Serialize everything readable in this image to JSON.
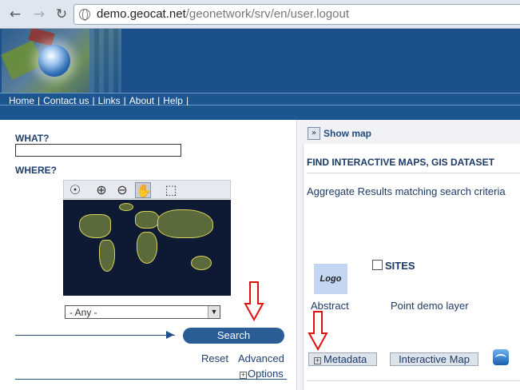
{
  "browser": {
    "url_host": "demo.geocat.net",
    "url_path": "/geonetwork/srv/en/user.logout"
  },
  "menu": [
    {
      "label": "Home"
    },
    {
      "label": "Contact us"
    },
    {
      "label": "Links"
    },
    {
      "label": "About"
    },
    {
      "label": "Help"
    }
  ],
  "search": {
    "what_label": "WHAT?",
    "what_value": "",
    "where_label": "WHERE?",
    "region_value": "- Any -",
    "search_label": "Search",
    "reset_label": "Reset",
    "advanced_label": "Advanced",
    "options_label": "Options"
  },
  "results": {
    "show_map_label": "Show map",
    "title": "FIND INTERACTIVE MAPS, GIS DATASET",
    "subtitle": "Aggregate Results matching search criteria",
    "logo_text": "Logo",
    "category": "SITES",
    "abstract_label": "Abstract",
    "layer_title": "Point demo layer",
    "metadata_label": "Metadata",
    "interactive_map_label": "Interactive Map"
  },
  "colors": {
    "banner": "#1a4f8a",
    "menu_bg": "#1d5590",
    "search_button": "#2a5d96",
    "annotation_red": "#e01010"
  }
}
